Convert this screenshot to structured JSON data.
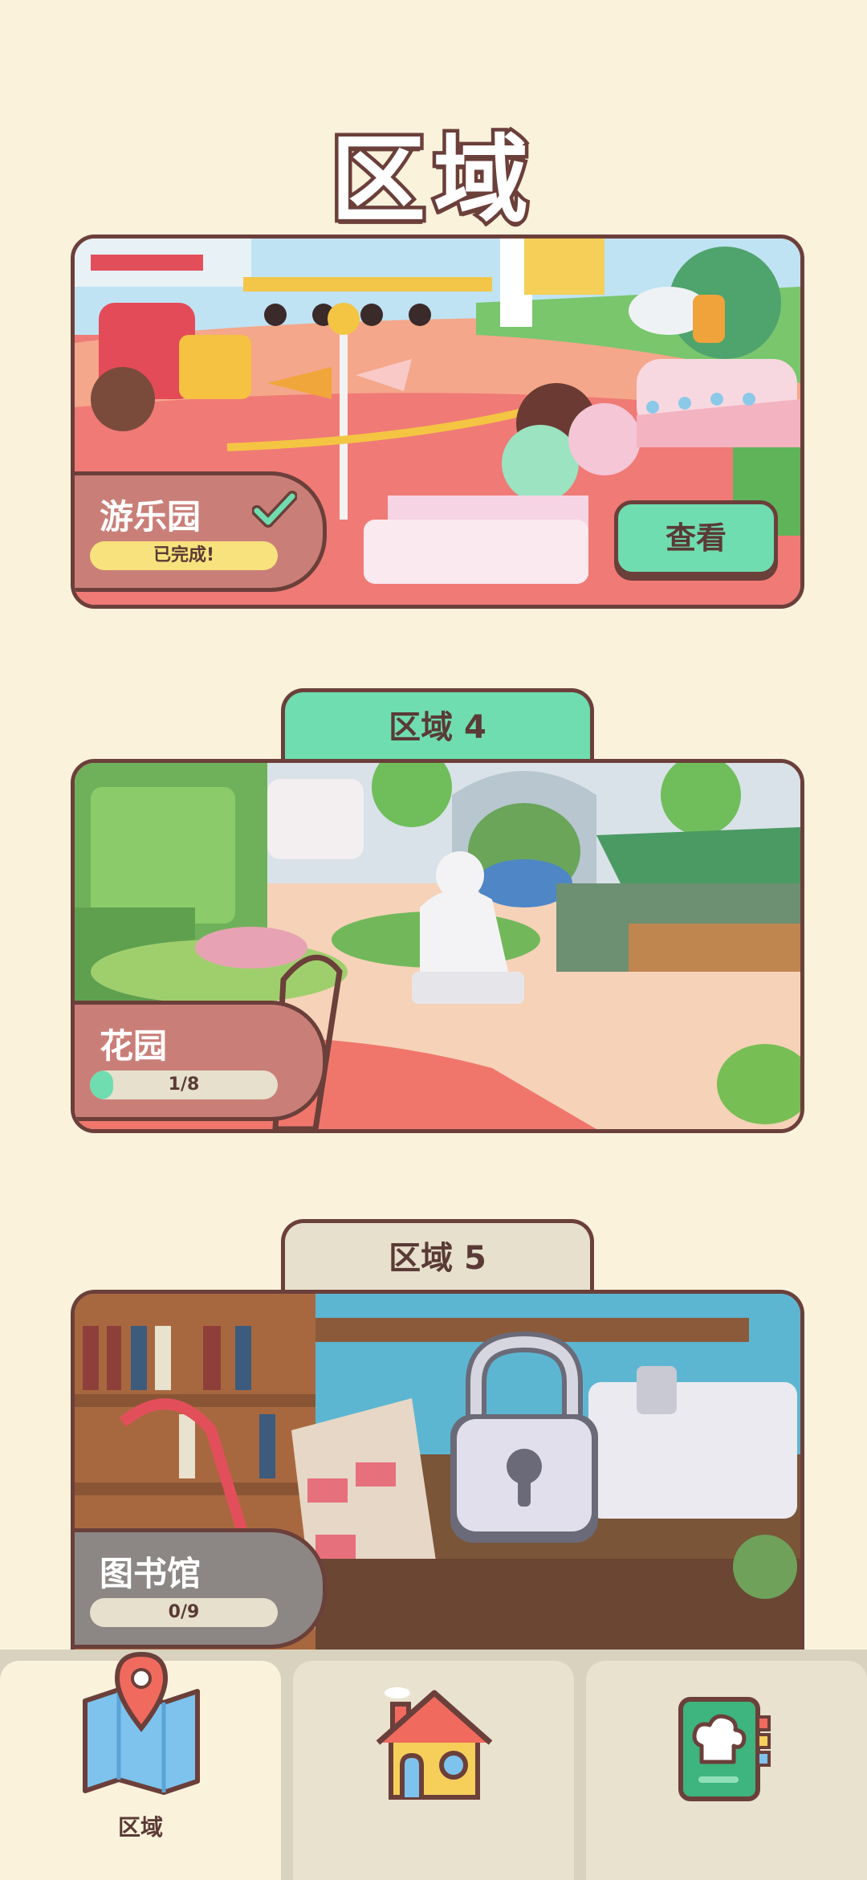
{
  "header": {
    "title": "区域"
  },
  "cards": [
    {
      "name": "游乐园",
      "status_text": "已完成!",
      "completed": true,
      "button_label": "查看",
      "locked": false
    },
    {
      "zone_tag": "区域 4",
      "name": "花园",
      "progress_text": "1/8",
      "progress": 0.125,
      "locked": false
    },
    {
      "zone_tag": "区域 5",
      "name": "图书馆",
      "progress_text": "0/9",
      "progress": 0,
      "locked": true
    }
  ],
  "bottom_nav": {
    "tabs": [
      {
        "icon": "map-pin-icon",
        "label": "区域",
        "active": true
      },
      {
        "icon": "house-icon",
        "label": "",
        "active": false
      },
      {
        "icon": "recipe-book-icon",
        "label": "",
        "active": false
      }
    ]
  },
  "colors": {
    "background": "#fbf2dc",
    "accent_green": "#6fddaf",
    "outline": "#6b3f3a",
    "label_pink": "#c97f78",
    "label_grey": "#8c8785"
  }
}
